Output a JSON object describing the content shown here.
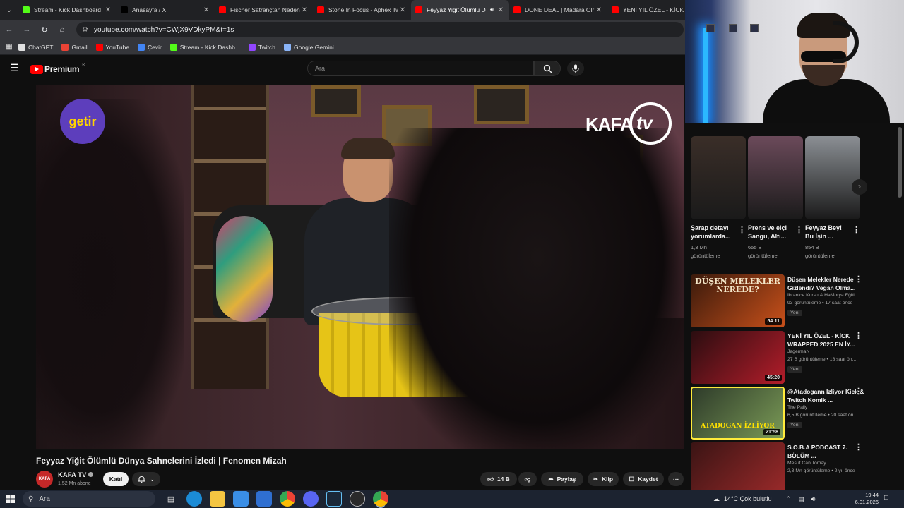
{
  "browser": {
    "tabs": [
      {
        "title": "Stream - Kick Dashboard",
        "favicon_color": "#53fc18",
        "active": false
      },
      {
        "title": "Anasayfa / X",
        "favicon_color": "#000000",
        "active": false
      },
      {
        "title": "Fischer Satrançtan Neden",
        "favicon_color": "#ff0000",
        "active": false
      },
      {
        "title": "Stone In Focus - Aphex Tw",
        "favicon_color": "#ff0000",
        "active": false
      },
      {
        "title": "Feyyaz Yiğit Ölümlü D",
        "favicon_color": "#ff0000",
        "active": true
      },
      {
        "title": "DONE DEAL | Madara Olr",
        "favicon_color": "#ff0000",
        "active": false
      },
      {
        "title": "YENİ YIL ÖZEL - KİCK WR",
        "favicon_color": "#ff0000",
        "active": false
      }
    ],
    "address": "youtube.com/watch?v=CWjX9VDkyPM&t=1s",
    "bookmarks": [
      {
        "label": "ChatGPT",
        "color": "#e0e0e0"
      },
      {
        "label": "Gmail",
        "color": "#ea4335"
      },
      {
        "label": "YouTube",
        "color": "#ff0000"
      },
      {
        "label": "Çevir",
        "color": "#4285f4"
      },
      {
        "label": "Stream - Kick Dashb...",
        "color": "#53fc18"
      },
      {
        "label": "Twitch",
        "color": "#9146ff"
      },
      {
        "label": "Google Gemini",
        "color": "#8ab4f8"
      }
    ]
  },
  "youtube": {
    "logo_word": "Premium",
    "logo_region": "TR",
    "search_placeholder": "Ara"
  },
  "video": {
    "title": "Feyyaz Yiğit Ölümlü Dünya Sahnelerini İzledi | Fenomen Mizah",
    "sponsor_logo": "getir",
    "watermark_kafa": "KAFA",
    "watermark_tv": "tv",
    "channel": {
      "name": "KAFA TV",
      "subscribers": "1,52 Mn abone",
      "join_label": "Katıl",
      "avatar_text": "KAFA"
    },
    "actions": {
      "likes": "14 B",
      "share": "Paylaş",
      "clip": "Klip",
      "save": "Kaydet"
    }
  },
  "shorts": [
    {
      "title": "Şarap detayı yorumlarda...",
      "views": "1,3 Mn görüntüleme",
      "color": "#3a2e28"
    },
    {
      "title": "Prens ve elçi Sangu, Altı...",
      "views": "655 B görüntüleme",
      "color": "#6b4a5a"
    },
    {
      "title": "Feyyaz Bey! Bu İşin ...",
      "views": "854 B görüntüleme",
      "color": "#8b8f94"
    }
  ],
  "recommendations": [
    {
      "title": "Düşen Melekler Nerede Gizlendi? Vegan Olma...",
      "channel": "İbranice Kursu & HaMorya Eğiti...",
      "meta": "93 görüntüleme • 17 saat önce",
      "badge": "Yeni",
      "duration": "54:11",
      "thumb_text": "DÜŞEN MELEKLER NEREDE?",
      "colors": [
        "#3a1a0c",
        "#c8501a"
      ],
      "highlight": false
    },
    {
      "title": "YENİ YIL ÖZEL - KİCK WRAPPED 2025 EN İY...",
      "channel": "JagermaN",
      "meta": "27 B görüntüleme • 18 saat ön...",
      "badge": "Yeni",
      "duration": "45:20",
      "thumb_text": "",
      "colors": [
        "#2a0d10",
        "#b31d2a"
      ],
      "highlight": false
    },
    {
      "title": "@Atadogann İzliyor Kick & Twitch Komik ...",
      "channel": "The Pally",
      "meta": "6,5 B görüntüleme • 20 saat ön...",
      "badge": "Yeni",
      "duration": "21:58",
      "thumb_text": "ATADOGAN İZLİYOR",
      "colors": [
        "#2e3b2a",
        "#7a9a56"
      ],
      "highlight": true
    },
    {
      "title": "S.O.B.A PODCAST 7. BÖLÜM ...",
      "channel": "Mesut Can Tomay",
      "meta": "2,3 Mn görüntüleme • 2 yıl önce",
      "badge": "",
      "duration": "",
      "thumb_text": "",
      "colors": [
        "#3a1414",
        "#9b2a2a"
      ],
      "highlight": false
    }
  ],
  "taskbar": {
    "search_label": "Ara",
    "weather": "14°C  Çok bulutlu",
    "time": "19:44",
    "date": "6.01.2026"
  }
}
